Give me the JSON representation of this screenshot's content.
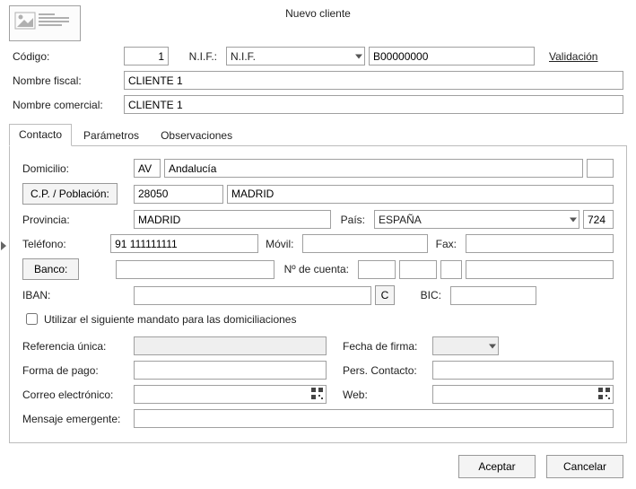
{
  "title": "Nuevo cliente",
  "header": {
    "codigo_label": "Código:",
    "codigo_value": "1",
    "nif_label": "N.I.F.:",
    "nif_type": "N.I.F.",
    "nif_value": "B00000000",
    "validacion": "Validación",
    "nombre_fiscal_label": "Nombre fiscal:",
    "nombre_fiscal_value": "CLIENTE 1",
    "nombre_comercial_label": "Nombre comercial:",
    "nombre_comercial_value": "CLIENTE 1"
  },
  "tabs": {
    "contacto": "Contacto",
    "parametros": "Parámetros",
    "observaciones": "Observaciones"
  },
  "contacto": {
    "domicilio_label": "Domicilio:",
    "domicilio_tipo": "AV",
    "domicilio_nombre": "Andalucía",
    "cp_poblacion_btn": "C.P. / Población:",
    "cp_value": "28050",
    "poblacion_value": "MADRID",
    "provincia_label": "Provincia:",
    "provincia_value": "MADRID",
    "pais_label": "País:",
    "pais_value": "ESPAÑA",
    "pais_code": "724",
    "telefono_label": "Teléfono:",
    "telefono_value": "91 111111111",
    "movil_label": "Móvil:",
    "fax_label": "Fax:",
    "banco_btn": "Banco:",
    "numero_cuenta_label": "Nº de cuenta:",
    "iban_label": "IBAN:",
    "iban_c_btn": "C",
    "bic_label": "BIC:",
    "chk_mandato": "Utilizar el siguiente mandato para las domiciliaciones",
    "referencia_label": "Referencia única:",
    "fecha_firma_label": "Fecha de firma:",
    "forma_pago_label": "Forma de pago:",
    "pers_contacto_label": "Pers. Contacto:",
    "correo_label": "Correo electrónico:",
    "web_label": "Web:",
    "mensaje_label": "Mensaje emergente:"
  },
  "footer": {
    "aceptar": "Aceptar",
    "cancelar": "Cancelar"
  }
}
